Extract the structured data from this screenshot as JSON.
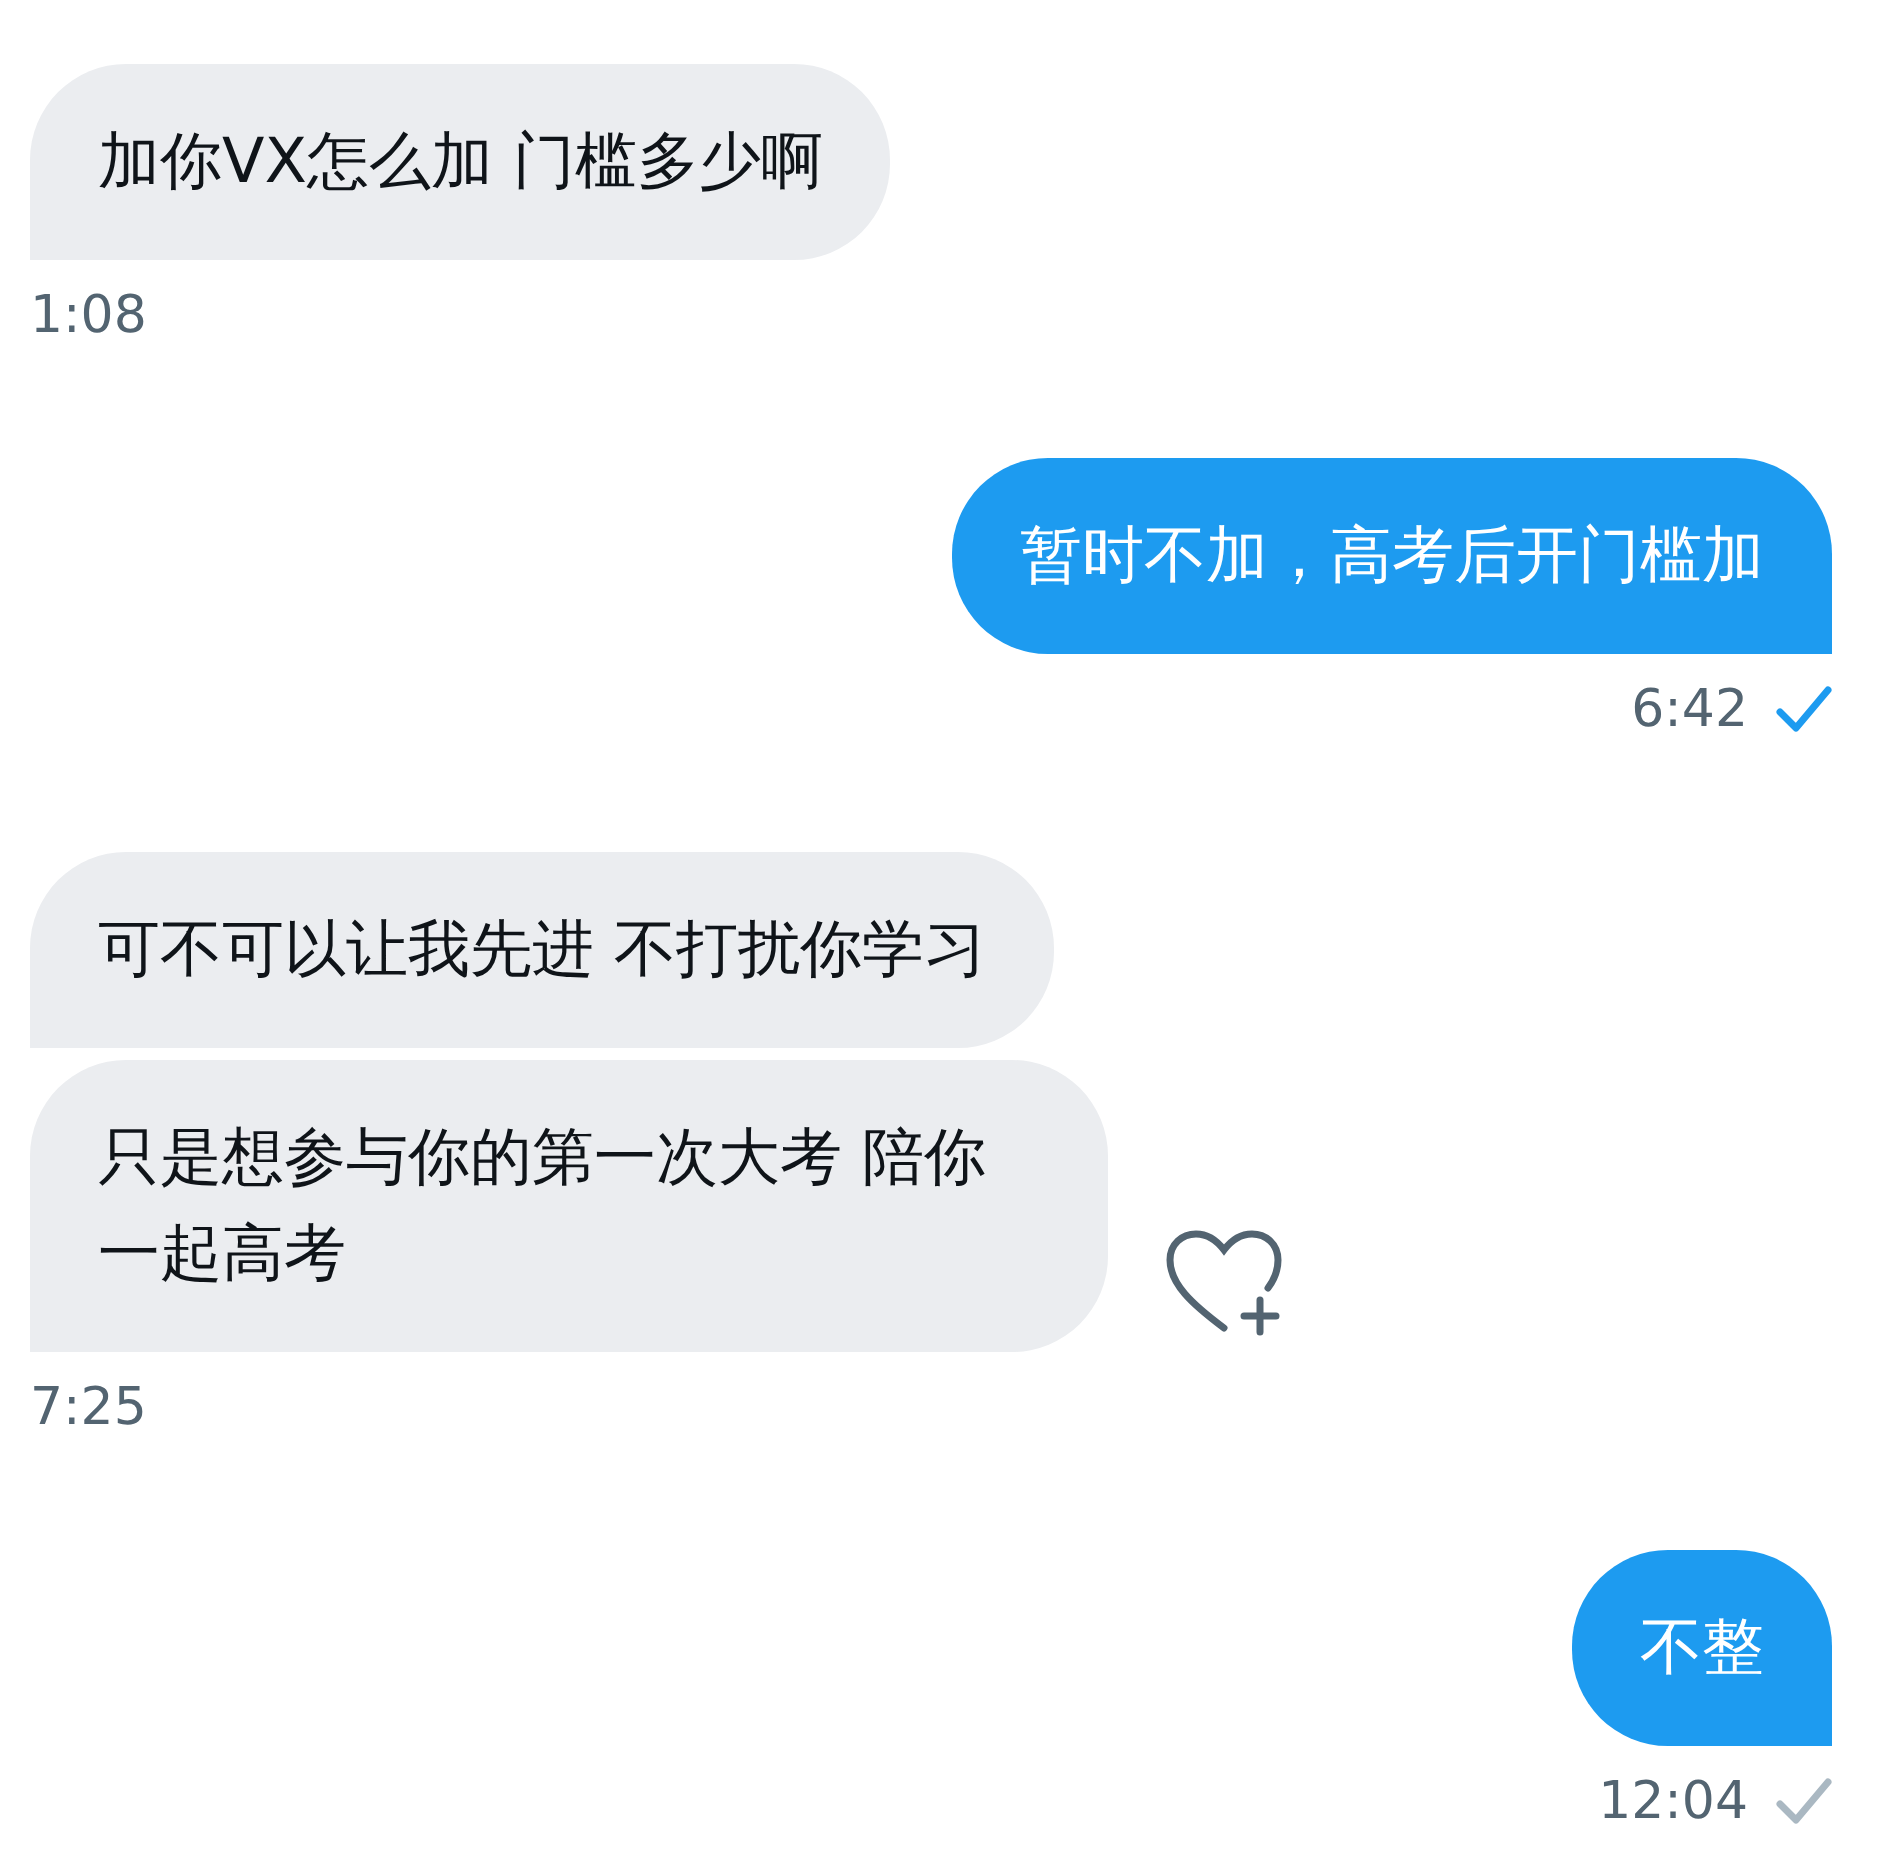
{
  "messages": [
    {
      "kind": "incoming",
      "bubbles": [
        "加你VX怎么加  门槛多少啊"
      ],
      "time": "1:08"
    },
    {
      "kind": "outgoing",
      "bubbles": [
        "暂时不加，高考后开门槛加"
      ],
      "time": "6:42",
      "read": true
    },
    {
      "kind": "incoming",
      "bubbles": [
        "可不可以让我先进  不打扰你学习",
        "只是想参与你的第一次大考  陪你一起高考"
      ],
      "time": "7:25",
      "reaction_button": true
    },
    {
      "kind": "outgoing",
      "bubbles": [
        "不整"
      ],
      "time": "12:04",
      "read": false
    }
  ]
}
